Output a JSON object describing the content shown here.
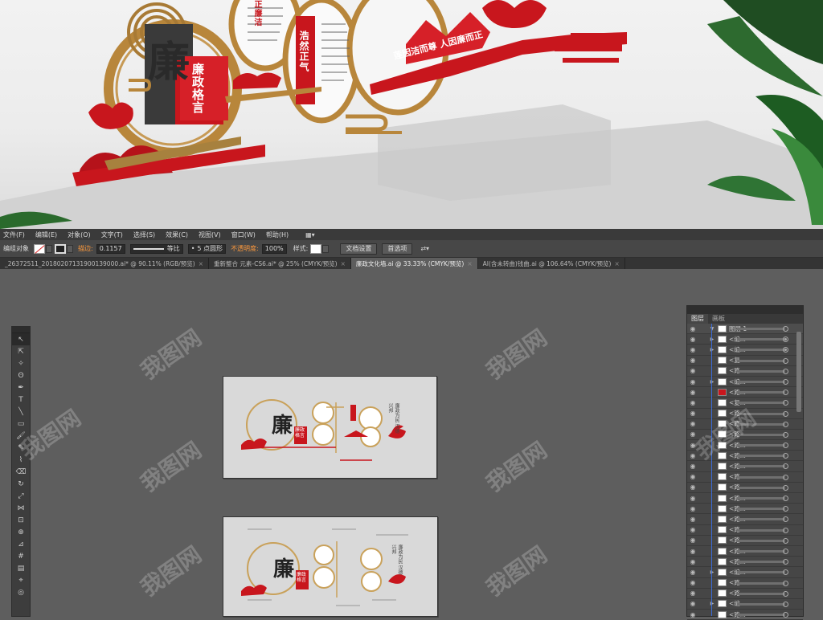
{
  "render": {
    "char_big": "廉",
    "plaque": "廉政格言",
    "circle_text_1": "浩然正气",
    "circle_text_2": "正廉洁",
    "banner": "莲因洁而尊  人因廉而正"
  },
  "menubar": {
    "items": [
      "文件(F)",
      "编辑(E)",
      "对象(O)",
      "文字(T)",
      "选择(S)",
      "效果(C)",
      "视图(V)",
      "窗口(W)",
      "帮助(H)"
    ]
  },
  "control_bar": {
    "object_label": "编组对象",
    "stroke_label": "描边:",
    "stroke_value": "0.1157",
    "line_label": "等比",
    "brush_value": "5 点圆形",
    "opacity_label": "不透明度:",
    "opacity_value": "100%",
    "style_label": "样式:",
    "doc_setup": "文档设置",
    "preferences": "首选项"
  },
  "tabs": [
    {
      "label": "_26372511_20180207131900139000.ai* @ 90.11% (RGB/预览)",
      "active": false
    },
    {
      "label": "重新整合 元素-CS6.ai* @ 25% (CMYK/预览)",
      "active": false
    },
    {
      "label": "廉政文化墙.ai @ 33.33% (CMYK/预览)",
      "active": true
    },
    {
      "label": "AI(含未转曲)钱曲.ai @ 106.64% (CMYK/预览)",
      "active": false
    }
  ],
  "layers_panel": {
    "tab_layers": "图层",
    "tab_artboards": "画板",
    "rows": [
      {
        "name": "图层 1",
        "twist": "▼",
        "target": "ring",
        "top": true
      },
      {
        "name": "<编...",
        "twist": "▶",
        "target": "filled"
      },
      {
        "name": "<编...",
        "twist": "▶",
        "target": "filled"
      },
      {
        "name": "<复...",
        "twist": "",
        "target": "ring"
      },
      {
        "name": "<路...",
        "twist": "",
        "target": "ring"
      },
      {
        "name": "<编...",
        "twist": "▶",
        "target": "ring"
      },
      {
        "name": "<路...",
        "twist": "",
        "target": "ring",
        "red": true
      },
      {
        "name": "<复...",
        "twist": "",
        "target": "ring"
      },
      {
        "name": "<路...",
        "twist": "",
        "target": "ring"
      },
      {
        "name": "<路...",
        "twist": "",
        "target": "ring"
      },
      {
        "name": "<路...",
        "twist": "",
        "target": "ring"
      },
      {
        "name": "<路...",
        "twist": "",
        "target": "ring"
      },
      {
        "name": "<路...",
        "twist": "",
        "target": "ring"
      },
      {
        "name": "<路...",
        "twist": "",
        "target": "ring"
      },
      {
        "name": "<路...",
        "twist": "",
        "target": "ring"
      },
      {
        "name": "<路...",
        "twist": "",
        "target": "ring"
      },
      {
        "name": "<路...",
        "twist": "",
        "target": "ring"
      },
      {
        "name": "<路...",
        "twist": "",
        "target": "ring"
      },
      {
        "name": "<路...",
        "twist": "",
        "target": "ring"
      },
      {
        "name": "<路...",
        "twist": "",
        "target": "ring"
      },
      {
        "name": "<路...",
        "twist": "",
        "target": "ring"
      },
      {
        "name": "<路...",
        "twist": "",
        "target": "ring"
      },
      {
        "name": "<路...",
        "twist": "",
        "target": "ring"
      },
      {
        "name": "<编...",
        "twist": "▶",
        "target": "ring"
      },
      {
        "name": "<路...",
        "twist": "",
        "target": "ring"
      },
      {
        "name": "<路...",
        "twist": "",
        "target": "ring"
      },
      {
        "name": "<编...",
        "twist": "▶",
        "target": "ring"
      },
      {
        "name": "<路...",
        "twist": "",
        "target": "ring"
      }
    ]
  },
  "artboard1": {
    "char": "廉",
    "plaque": "廉政格言",
    "right_text": "廉政为民 汉德兴邦"
  },
  "artboard2": {
    "char": "廉",
    "plaque": "廉政格言",
    "right_text": "廉政为民 汉德兴邦"
  },
  "watermark": "我图网",
  "colors": {
    "accent_red": "#c8161d",
    "gold": "#b8863b",
    "ui_dark": "#3a3a3a",
    "selection_blue": "#3b6bd6"
  },
  "icons": [
    "selection-icon",
    "direct-selection-icon",
    "magic-wand-icon",
    "lasso-icon",
    "pen-icon",
    "type-icon",
    "line-icon",
    "rectangle-icon",
    "brush-icon",
    "pencil-icon",
    "blob-brush-icon",
    "eraser-icon",
    "rotate-icon",
    "scale-icon",
    "width-icon",
    "free-transform-icon",
    "shape-builder-icon",
    "perspective-icon",
    "mesh-icon",
    "gradient-icon",
    "eyedropper-icon",
    "blend-icon"
  ]
}
